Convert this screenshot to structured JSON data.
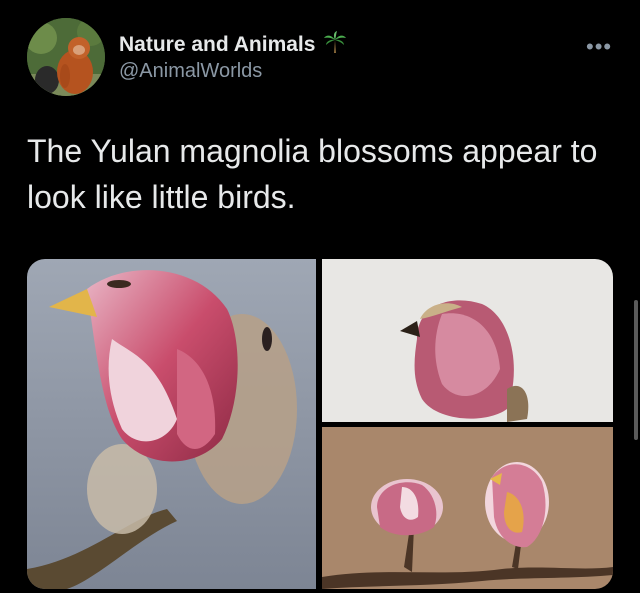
{
  "tweet": {
    "author_name": "Nature and Animals",
    "author_emoji": "🌴",
    "handle": "@AnimalWorlds",
    "more_label": "•••",
    "text": "The Yulan magnolia blossoms appear to look like little birds."
  },
  "colors": {
    "background": "#000000",
    "text": "#e7e9ea",
    "secondary": "#8b98a5"
  },
  "icons": {
    "more": "more-options-icon",
    "emoji": "palm-tree-icon"
  }
}
